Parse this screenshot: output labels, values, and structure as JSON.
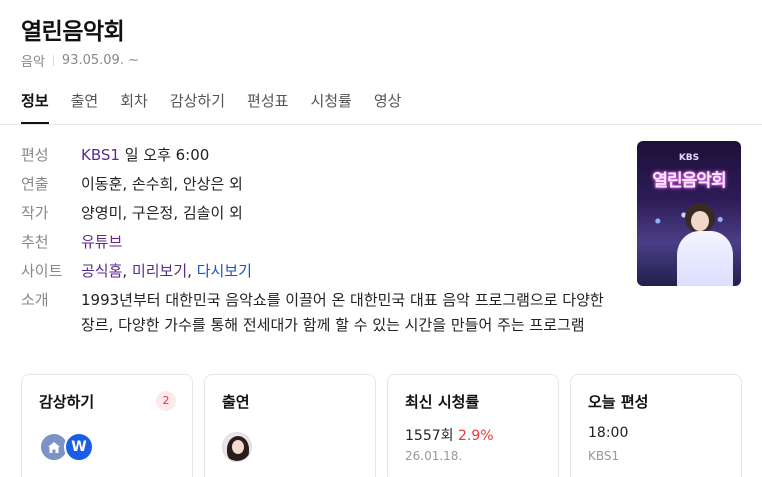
{
  "header": {
    "title": "열린음악회",
    "genre": "음악",
    "period": "93.05.09. ~"
  },
  "tabs": [
    {
      "label": "정보",
      "active": true
    },
    {
      "label": "출연"
    },
    {
      "label": "회차"
    },
    {
      "label": "감상하기"
    },
    {
      "label": "편성표"
    },
    {
      "label": "시청률"
    },
    {
      "label": "영상"
    }
  ],
  "info": {
    "schedule": {
      "label": "편성",
      "channel": "KBS1",
      "time": " 일 오후 6:00"
    },
    "director": {
      "label": "연출",
      "value": "이동훈, 손수희, 안상은 외"
    },
    "writer": {
      "label": "작가",
      "value": "양영미, 구은정, 김솔이 외"
    },
    "recommend": {
      "label": "추천",
      "link": "유튜브"
    },
    "site": {
      "label": "사이트",
      "link1": "공식홈",
      "sep1": ", ",
      "link2": "미리보기",
      "sep2": ", ",
      "link3": "다시보기"
    },
    "intro": {
      "label": "소개",
      "value": "1993년부터 대한민국 음악쇼를 이끌어 온 대한민국 대표 음악 프로그램으로 다양한 장르, 다양한 가수를 통해 전세대가 함께 할 수 있는 시간을 만들어 주는 프로그램"
    }
  },
  "poster": {
    "brand": "KBS",
    "logo_text": "열린음악회"
  },
  "cards": {
    "watch": {
      "title": "감상하기",
      "count": "2",
      "icons": [
        "home-icon",
        "wavve-icon"
      ],
      "w_letter": "W"
    },
    "cast": {
      "title": "출연"
    },
    "rating": {
      "title": "최신 시청률",
      "episode": "1557회",
      "rate": "2.9%",
      "date": "26.01.18."
    },
    "today": {
      "title": "오늘 편성",
      "time": "18:00",
      "channel": "KBS1"
    }
  },
  "colors": {
    "link_purple": "#5a2a8c",
    "link_blue": "#1a56c7",
    "accent_red": "#e5393b"
  }
}
